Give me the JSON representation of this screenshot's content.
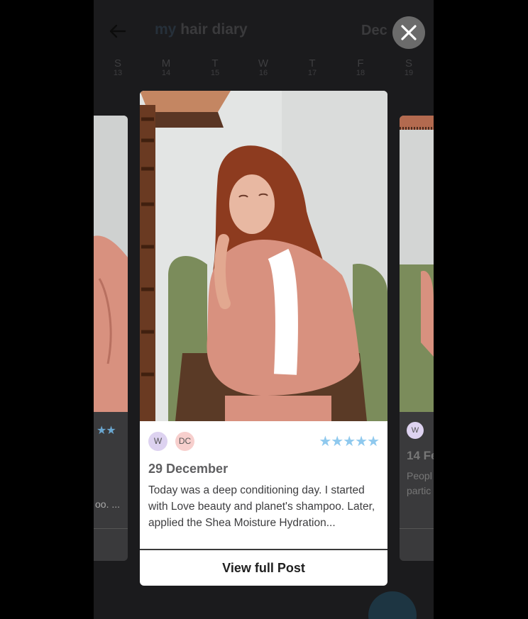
{
  "app": {
    "title_prefix": "my",
    "title_rest": " hair diary",
    "month": "Dec"
  },
  "week": [
    {
      "letter": "S",
      "date": "13"
    },
    {
      "letter": "M",
      "date": "14"
    },
    {
      "letter": "T",
      "date": "15"
    },
    {
      "letter": "W",
      "date": "16"
    },
    {
      "letter": "T",
      "date": "17"
    },
    {
      "letter": "F",
      "date": "18"
    },
    {
      "letter": "S",
      "date": "19"
    }
  ],
  "post": {
    "chips": [
      "W",
      "DC"
    ],
    "stars": "★★★★★",
    "rating": 5,
    "date": "29 December",
    "text": "Today was a deep conditioning day. I started with Love beauty and planet's shampoo. Later, applied the Shea Moisture Hydration...",
    "view_label": "View full Post"
  },
  "left_card": {
    "stars": "★★",
    "snippet": "oo. ..."
  },
  "right_card": {
    "chip": "W",
    "date": "14 Fe",
    "text_line1": "Peopl",
    "text_line2": "partic"
  },
  "colors": {
    "star": "#8fc9ee",
    "chip_w": "#ddd2f0",
    "chip_dc": "#f7cfcd"
  },
  "icons": {
    "back": "arrow-left-icon",
    "close": "close-icon"
  }
}
